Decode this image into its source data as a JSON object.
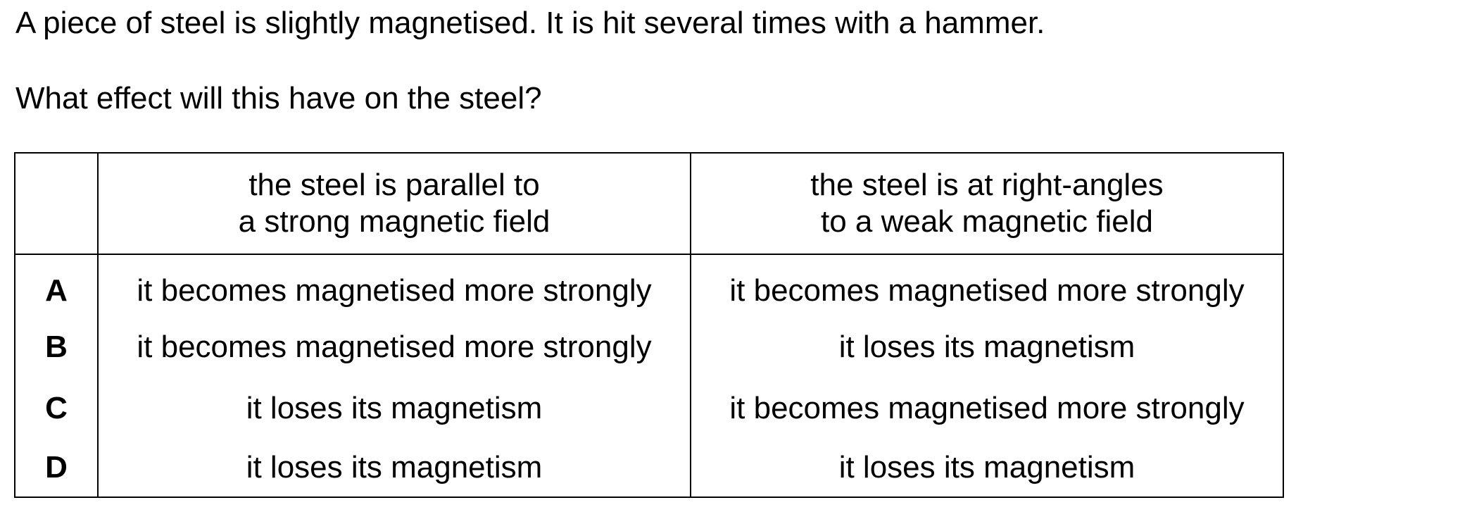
{
  "question": {
    "intro": "A piece of steel is slightly magnetised. It is hit several times with a hammer.",
    "prompt": "What effect will this have on the steel?"
  },
  "table": {
    "headers": {
      "col1": [
        "the steel is parallel to",
        "a strong magnetic field"
      ],
      "col2": [
        "the steel is at right-angles",
        "to a weak magnetic field"
      ]
    },
    "rows": [
      {
        "letter": "A",
        "col1": "it becomes magnetised more strongly",
        "col2": "it becomes magnetised more strongly"
      },
      {
        "letter": "B",
        "col1": "it becomes magnetised more strongly",
        "col2": "it loses its magnetism"
      },
      {
        "letter": "C",
        "col1": "it loses its magnetism",
        "col2": "it becomes magnetised more strongly"
      },
      {
        "letter": "D",
        "col1": "it loses its magnetism",
        "col2": "it loses its magnetism"
      }
    ]
  }
}
